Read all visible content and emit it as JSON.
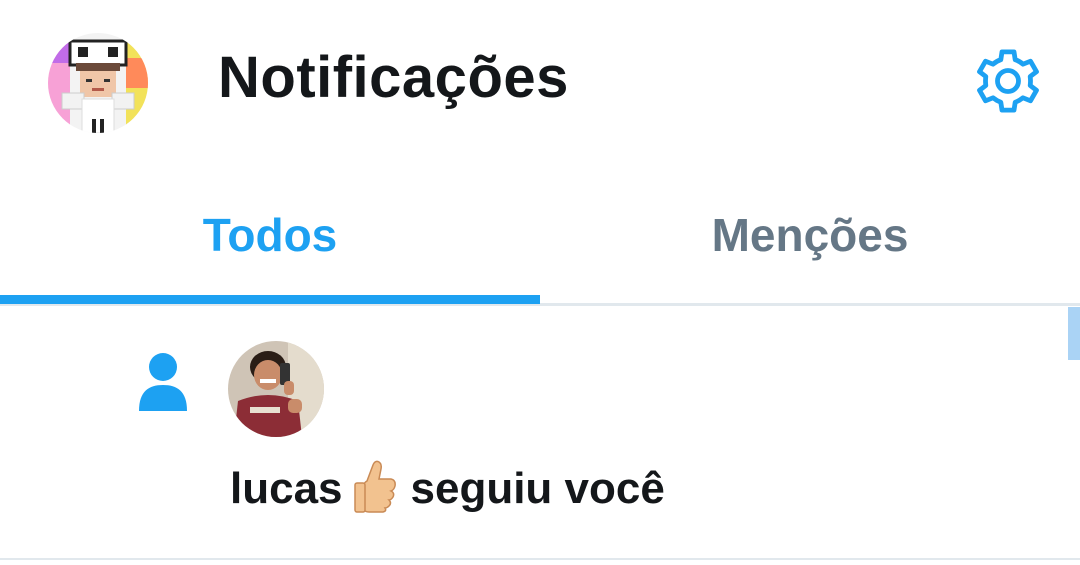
{
  "header": {
    "title": "Notificações",
    "profile_avatar_icon": "user-avatar",
    "settings_icon": "gear-icon"
  },
  "tabs": [
    {
      "label": "Todos",
      "active": true
    },
    {
      "label": "Menções",
      "active": false
    }
  ],
  "notifications": [
    {
      "type_icon": "person-follow-icon",
      "user": "lucas",
      "emoji": "thumbs-up",
      "action": "seguiu você"
    }
  ],
  "colors": {
    "accent": "#1da1f2",
    "text_primary": "#14171a",
    "text_secondary": "#657786",
    "divider": "#e1e8ed"
  }
}
